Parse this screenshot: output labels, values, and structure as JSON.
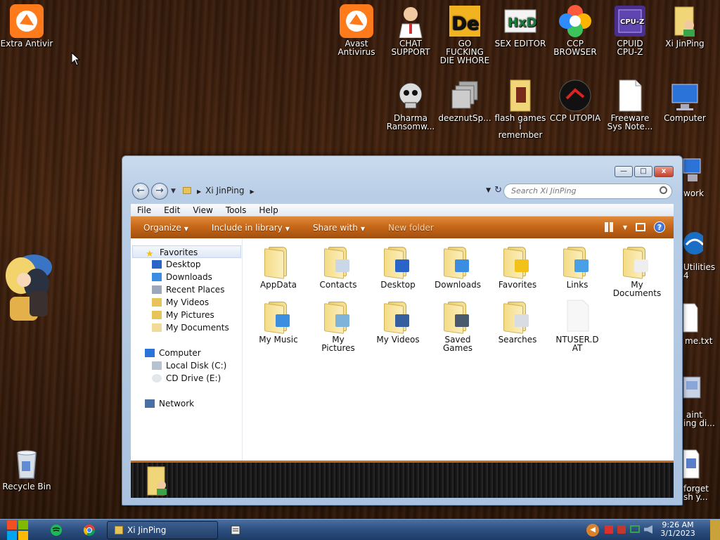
{
  "desktop": {
    "left_icons": [
      {
        "label": "Extra Antivir",
        "icon": "avast-icon"
      },
      {
        "label": "Recycle Bin",
        "icon": "recycle-bin-icon"
      }
    ],
    "top_row": [
      {
        "line1": "Avast",
        "line2": "Antivirus"
      },
      {
        "line1": "CHAT",
        "line2": "SUPPORT"
      },
      {
        "line1": "GO FUCKING",
        "line2": "DIE WHORE"
      },
      {
        "line1": "SEX EDITOR",
        "line2": ""
      },
      {
        "line1": "CCP",
        "line2": "BROWSER"
      },
      {
        "line1": "CPUID",
        "line2": "CPU-Z"
      },
      {
        "line1": "Xi JinPing",
        "line2": ""
      }
    ],
    "second_row": [
      {
        "line1": "Dharma",
        "line2": "Ransomw..."
      },
      {
        "line1": "deeznutSp...",
        "line2": ""
      },
      {
        "line1": "flash games i",
        "line2": "remember"
      },
      {
        "line1": "CCP UTOPIA",
        "line2": ""
      },
      {
        "line1": "Freeware",
        "line2": "Sys Note..."
      },
      {
        "line1": "Computer",
        "line2": ""
      }
    ],
    "partial_labels": [
      "work",
      "Utilities",
      "4",
      "me.txt",
      "aint",
      "ing di...",
      "forget",
      "sh y..."
    ],
    "cpuz_badge": "CPU-Z"
  },
  "window": {
    "address_path": "Xi JinPing",
    "search_placeholder": "Search Xi JinPing",
    "menu": [
      "File",
      "Edit",
      "View",
      "Tools",
      "Help"
    ],
    "toolbar": {
      "organize": "Organize",
      "include": "Include in library",
      "share": "Share with",
      "new_folder": "New folder"
    },
    "nav": {
      "favorites": "Favorites",
      "fav_items": [
        "Desktop",
        "Downloads",
        "Recent Places",
        "My Videos",
        "My Pictures",
        "My Documents"
      ],
      "computer": "Computer",
      "computer_items": [
        "Local Disk (C:)",
        "CD Drive (E:)"
      ],
      "network": "Network"
    },
    "files": [
      {
        "line1": "AppData",
        "line2": "",
        "badge": ""
      },
      {
        "line1": "Contacts",
        "line2": "",
        "badge": "#c9d7e8"
      },
      {
        "line1": "Desktop",
        "line2": "",
        "badge": "#2b64c9"
      },
      {
        "line1": "Downloads",
        "line2": "",
        "badge": "#3a8de0"
      },
      {
        "line1": "Favorites",
        "line2": "",
        "badge": "#f2c21a"
      },
      {
        "line1": "Links",
        "line2": "",
        "badge": "#4aa0e6"
      },
      {
        "line1": "My",
        "line2": "Documents",
        "badge": "#eeeeee"
      },
      {
        "line1": "My Music",
        "line2": "",
        "badge": "#3c8fe0"
      },
      {
        "line1": "My",
        "line2": "Pictures",
        "badge": "#7fb3d9"
      },
      {
        "line1": "My Videos",
        "line2": "",
        "badge": "#355f9e"
      },
      {
        "line1": "Saved",
        "line2": "Games",
        "badge": "#4a5a6e"
      },
      {
        "line1": "Searches",
        "line2": "",
        "badge": "#d9dde3"
      },
      {
        "line1": "NTUSER.D",
        "line2": "AT",
        "badge": "file"
      }
    ],
    "controls": {
      "minimize": "—",
      "maximize": "□",
      "close": "x"
    }
  },
  "taskbar": {
    "task_label": "Xi JinPing",
    "time": "9:26 AM",
    "date": "3/1/2023"
  },
  "colors": {
    "toolbar_orange": "#c8681a",
    "window_frame": "#b8cde6",
    "taskbar": "#2c4f80"
  }
}
